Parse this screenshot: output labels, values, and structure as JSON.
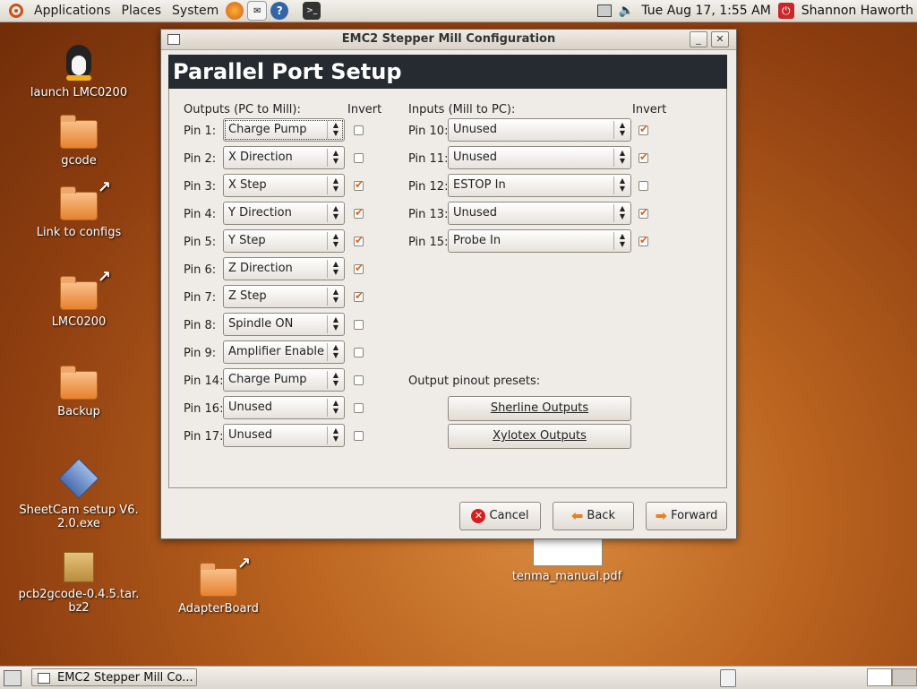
{
  "top_panel": {
    "menus": [
      "Applications",
      "Places",
      "System"
    ],
    "clock": "Tue Aug 17,  1:55 AM",
    "user": "Shannon Haworth"
  },
  "desktop": {
    "icons": [
      {
        "label": "launch LMC0200",
        "icon": "tux-icon"
      },
      {
        "label": "gcode",
        "icon": "folder-icon"
      },
      {
        "label": "Link to configs",
        "icon": "folder-link-icon"
      },
      {
        "label": "LMC0200",
        "icon": "folder-link-icon"
      },
      {
        "label": "Backup",
        "icon": "folder-icon"
      },
      {
        "label": "SheetCam setup V6.",
        "label2": "2.0.exe",
        "icon": "executable-icon"
      },
      {
        "label": "pcb2gcode-0.4.5.tar.",
        "label2": "bz2",
        "icon": "archive-icon"
      },
      {
        "label": "AdapterBoard",
        "icon": "folder-link-icon"
      },
      {
        "label": "tenma_manual.pdf",
        "icon": "pdf-icon"
      }
    ]
  },
  "window": {
    "title": "EMC2 Stepper Mill Configuration",
    "heading": "Parallel Port Setup",
    "outputs_header": "Outputs (PC to Mill):",
    "inputs_header": "Inputs (Mill to PC):",
    "invert_label": "Invert",
    "outputs": [
      {
        "label": "Pin 1:",
        "value": "Charge Pump",
        "invert": false
      },
      {
        "label": "Pin 2:",
        "value": "X Direction",
        "invert": false
      },
      {
        "label": "Pin 3:",
        "value": "X Step",
        "invert": true
      },
      {
        "label": "Pin 4:",
        "value": "Y Direction",
        "invert": true
      },
      {
        "label": "Pin 5:",
        "value": "Y Step",
        "invert": true
      },
      {
        "label": "Pin 6:",
        "value": "Z Direction",
        "invert": true
      },
      {
        "label": "Pin 7:",
        "value": "Z Step",
        "invert": true
      },
      {
        "label": "Pin 8:",
        "value": "Spindle ON",
        "invert": false
      },
      {
        "label": "Pin 9:",
        "value": "Amplifier Enable",
        "invert": false
      },
      {
        "label": "Pin 14:",
        "value": "Charge Pump",
        "invert": false
      },
      {
        "label": "Pin 16:",
        "value": "Unused",
        "invert": false
      },
      {
        "label": "Pin 17:",
        "value": "Unused",
        "invert": false
      }
    ],
    "inputs": [
      {
        "label": "Pin 10:",
        "value": "Unused",
        "invert": true
      },
      {
        "label": "Pin 11:",
        "value": "Unused",
        "invert": true
      },
      {
        "label": "Pin 12:",
        "value": "ESTOP In",
        "invert": false
      },
      {
        "label": "Pin 13:",
        "value": "Unused",
        "invert": true
      },
      {
        "label": "Pin 15:",
        "value": "Probe In",
        "invert": true
      }
    ],
    "presets_label": "Output pinout presets:",
    "preset_buttons": [
      "Sherline Outputs",
      "Xylotex Outputs"
    ],
    "buttons": {
      "cancel": "Cancel",
      "back": "Back",
      "forward": "Forward"
    }
  },
  "taskbar": {
    "task": "EMC2 Stepper Mill Co..."
  },
  "colors": {
    "check": "#d8671c",
    "header_band": "#262b31",
    "accent": "#e9801e"
  }
}
